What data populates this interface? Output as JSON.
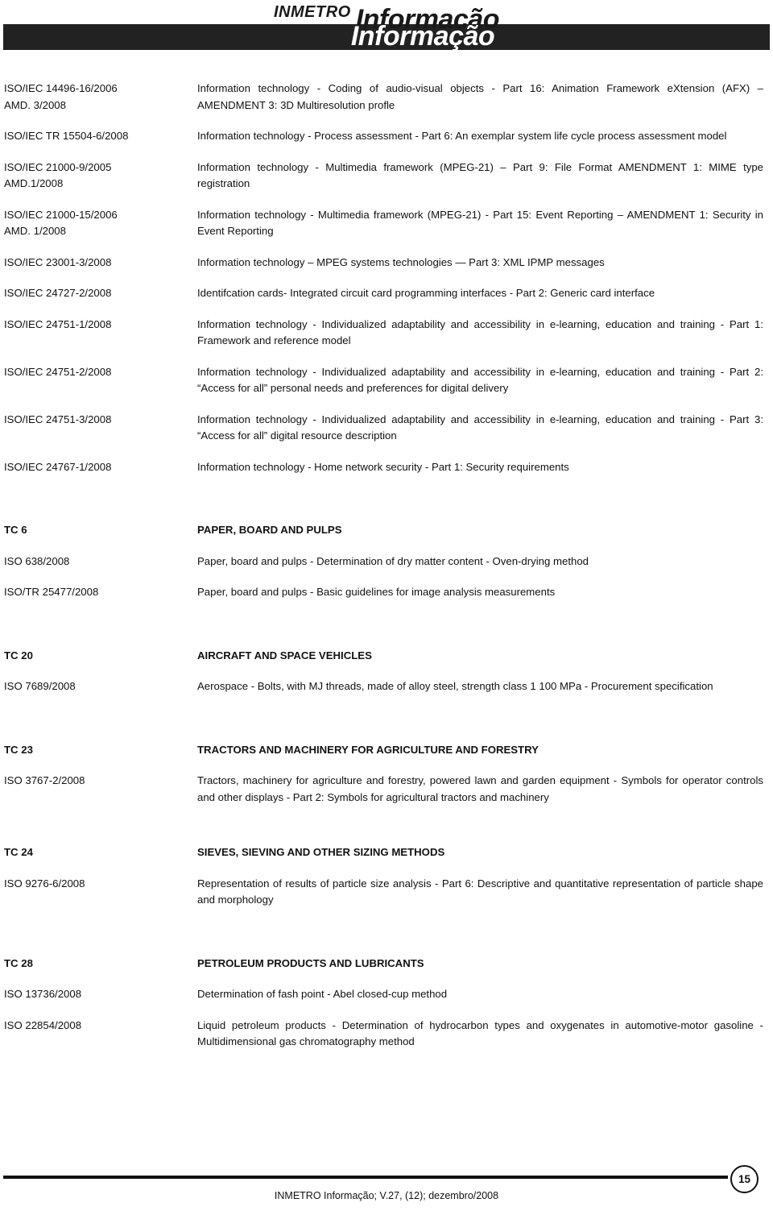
{
  "masthead": {
    "brand": "INMETRO",
    "title": "Informação",
    "title_ghost": "Informação"
  },
  "entries": [
    {
      "code": "ISO/IEC 14496-16/2006\nAMD.  3/2008",
      "desc": "Information technology - Coding of audio-visual objects - Part 16: Animation Framework eXtension (AFX) – AMENDMENT 3: 3D Multiresolution profle",
      "type": "item"
    },
    {
      "code": "ISO/IEC TR 15504-6/2008",
      "desc": "Information technology - Process assessment - Part 6: An exemplar system life cycle process assessment model",
      "type": "item"
    },
    {
      "code": "ISO/IEC 21000-9/2005\nAMD.1/2008",
      "desc": "Information technology - Multimedia framework (MPEG-21) – Part 9: File Format AMENDMENT 1: MIME type registration",
      "type": "item"
    },
    {
      "code": "ISO/IEC 21000-15/2006\nAMD.  1/2008",
      "desc": "Information technology - Multimedia framework (MPEG-21) - Part 15: Event Reporting – AMENDMENT 1: Security in Event Reporting",
      "type": "item"
    },
    {
      "code": "ISO/IEC 23001-3/2008",
      "desc": "Information technology – MPEG systems technologies — Part 3: XML IPMP messages",
      "type": "item"
    },
    {
      "code": "ISO/IEC 24727-2/2008",
      "desc": "Identifcation cards- Integrated circuit card programming interfaces - Part 2: Generic card interface",
      "type": "item"
    },
    {
      "code": "ISO/IEC 24751-1/2008",
      "desc": "Information technology - Individualized adaptability and accessibility in e-learning, education and training - Part 1: Framework and reference model",
      "type": "item"
    },
    {
      "code": "ISO/IEC 24751-2/2008",
      "desc": "Information technology - Individualized adaptability and accessibility in e-learning, education and training - Part 2: “Access for all” personal needs and preferences for digital delivery",
      "type": "item"
    },
    {
      "code": "ISO/IEC 24751-3/2008",
      "desc": "Information technology - Individualized adaptability and accessibility in e-learning, education and training - Part 3: “Access for all” digital resource description",
      "type": "item"
    },
    {
      "code": "ISO/IEC 24767-1/2008",
      "desc": "Information technology - Home network security - Part 1: Security requirements",
      "type": "item"
    },
    {
      "code": "TC 6",
      "desc": "PAPER, BOARD AND PULPS",
      "type": "tc"
    },
    {
      "code": "ISO 638/2008",
      "desc": "Paper, board and pulps - Determination of dry matter content  - Oven-drying method",
      "type": "item"
    },
    {
      "code": "ISO/TR 25477/2008",
      "desc": "Paper, board and pulps  - Basic guidelines for image analysis measurements",
      "type": "item"
    },
    {
      "code": "TC 20",
      "desc": "AIRCRAFT AND SPACE VEHICLES",
      "type": "tc"
    },
    {
      "code": "ISO 7689/2008",
      "desc": "Aerospace - Bolts, with MJ threads, made of alloy steel, strength class 1 100 MPa - Procurement specification",
      "type": "item"
    },
    {
      "code": "TC 23",
      "desc": "TRACTORS AND MACHINERY FOR AGRICULTURE AND FORESTRY",
      "type": "tc"
    },
    {
      "code": "ISO 3767-2/2008",
      "desc": "Tractors, machinery for agriculture and forestry, powered lawn and garden equipment  - Symbols for operator controls and other displays - Part 2: Symbols for agricultural tractors and machinery",
      "type": "item"
    },
    {
      "code": "TC 24",
      "desc": "SIEVES, SIEVING AND OTHER SIZING METHODS",
      "type": "tc"
    },
    {
      "code": "ISO 9276-6/2008",
      "desc": "Representation of results of particle size analysis - Part 6: Descriptive and quantitative representation of particle shape and morphology",
      "type": "item"
    },
    {
      "code": "TC 28",
      "desc": "PETROLEUM PRODUCTS AND LUBRICANTS",
      "type": "tc"
    },
    {
      "code": "ISO 13736/2008",
      "desc": "Determination of fash point - Abel closed-cup method",
      "type": "item"
    },
    {
      "code": "ISO 22854/2008",
      "desc": "Liquid petroleum products - Determination of hydrocarbon types and oxygenates in automotive-motor gasoline - Multidimensional gas chromatography method",
      "type": "item"
    }
  ],
  "footer": {
    "page_number": "15",
    "citation": "INMETRO Informação; V.27, (12); dezembro/2008"
  }
}
